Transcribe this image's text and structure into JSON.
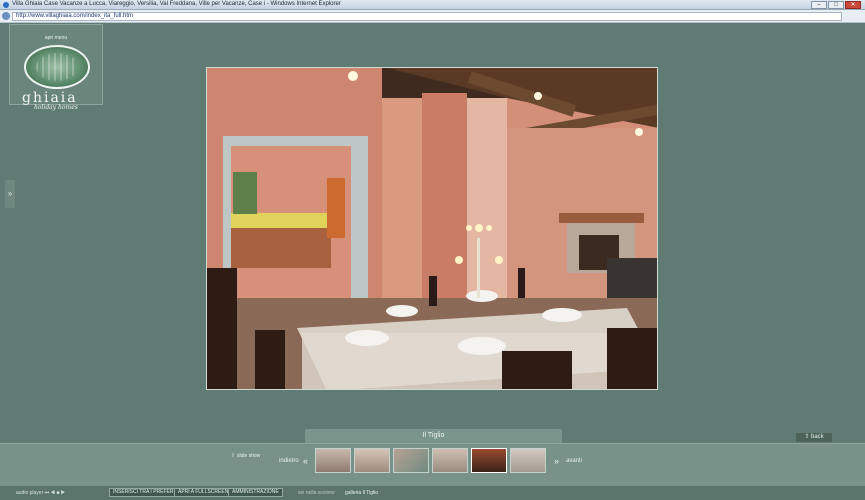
{
  "browser": {
    "window_title": "Villa Ghiaia Case Vacanze a Lucca, Viareggio, Versilia, Val Freddana, Ville per Vacanze, Case i - Windows Internet Explorer",
    "url": "http://www.villaghiaia.com/index_ita_full.htm",
    "window_controls": [
      "–",
      "□",
      "✕"
    ]
  },
  "sidebar": {
    "menu_label": "apri menu",
    "brand": "ghiaia",
    "brand_tagline": "holiday homes",
    "toggle_icon": "double-chevron-right-icon"
  },
  "gallery": {
    "current_title": "Il Tiglio",
    "back_label": "back",
    "slideshow_label": "slide show",
    "prev_label": "indietro",
    "next_label": "avanti",
    "active_thumb_index": 4,
    "thumbnail_count": 6
  },
  "footer": {
    "audio_player_label": "audio player",
    "audio_controls": "⏮ ◀ ■ ▶",
    "buttons": [
      "INSERISCI TRA I PREFERITI",
      "APRI A FULLSCREEN",
      "AMMINISTRAZIONE"
    ],
    "crumb_prefix": "sei nella sezione",
    "crumb_current": "galleria Il Tiglio"
  },
  "colors": {
    "background": "#607b73",
    "gallery_bar": "#789189",
    "title_tab": "#7b958c"
  }
}
